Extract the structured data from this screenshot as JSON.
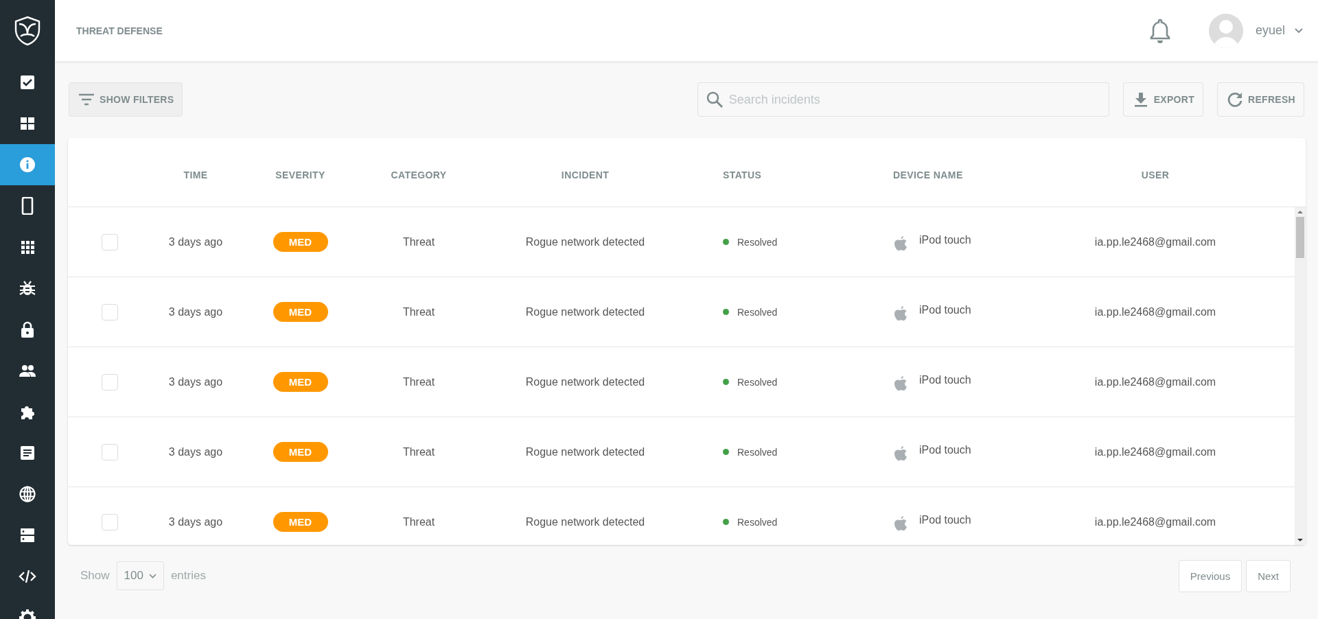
{
  "sidebar": {
    "items": [
      {
        "kind": "tasks",
        "selected": false
      },
      {
        "kind": "dashboard",
        "selected": false
      },
      {
        "kind": "info",
        "selected": true
      },
      {
        "kind": "phone",
        "selected": false
      },
      {
        "kind": "apps",
        "selected": false
      },
      {
        "kind": "bug",
        "selected": false
      },
      {
        "kind": "lock",
        "selected": false
      },
      {
        "kind": "people",
        "selected": false
      },
      {
        "kind": "puzzle",
        "selected": false
      },
      {
        "kind": "document",
        "selected": false
      },
      {
        "kind": "globe",
        "selected": false
      },
      {
        "kind": "server",
        "selected": false
      },
      {
        "kind": "code",
        "selected": false
      },
      {
        "kind": "gear",
        "selected": false
      }
    ]
  },
  "header": {
    "title": "THREAT DEFENSE",
    "user": "eyuel"
  },
  "toolbar": {
    "filters_button": "SHOW FILTERS",
    "search": {
      "placeholder": "Search incidents"
    },
    "export_button": "EXPORT",
    "refresh_button": "REFRESH"
  },
  "table": {
    "columns": [
      "TIME",
      "SEVERITY",
      "CATEGORY",
      "INCIDENT",
      "STATUS",
      "DEVICE NAME",
      "USER"
    ],
    "rows": [
      {
        "checked": false,
        "time": "3 days ago",
        "severity": {
          "label": "MED",
          "color": "#ff9800"
        },
        "category": "Threat",
        "incident": "Rogue network detected",
        "status": {
          "label": "Resolved",
          "color": "#43a047"
        },
        "device": "iPod touch",
        "user": "ia.pp.le2468@gmail.com"
      },
      {
        "checked": false,
        "time": "3 days ago",
        "severity": {
          "label": "MED",
          "color": "#ff9800"
        },
        "category": "Threat",
        "incident": "Rogue network detected",
        "status": {
          "label": "Resolved",
          "color": "#43a047"
        },
        "device": "iPod touch",
        "user": "ia.pp.le2468@gmail.com"
      },
      {
        "checked": false,
        "time": "3 days ago",
        "severity": {
          "label": "MED",
          "color": "#ff9800"
        },
        "category": "Threat",
        "incident": "Rogue network detected",
        "status": {
          "label": "Resolved",
          "color": "#43a047"
        },
        "device": "iPod touch",
        "user": "ia.pp.le2468@gmail.com"
      },
      {
        "checked": false,
        "time": "3 days ago",
        "severity": {
          "label": "MED",
          "color": "#ff9800"
        },
        "category": "Threat",
        "incident": "Rogue network detected",
        "status": {
          "label": "Resolved",
          "color": "#43a047"
        },
        "device": "iPod touch",
        "user": "ia.pp.le2468@gmail.com"
      },
      {
        "checked": false,
        "time": "3 days ago",
        "severity": {
          "label": "MED",
          "color": "#ff9800"
        },
        "category": "Threat",
        "incident": "Rogue network detected",
        "status": {
          "label": "Resolved",
          "color": "#43a047"
        },
        "device": "iPod touch",
        "user": "ia.pp.le2468@gmail.com"
      }
    ]
  },
  "footer": {
    "show_label": "Show",
    "page_size": "100",
    "entries_label": "entries",
    "previous_button": "Previous",
    "next_button": "Next"
  }
}
